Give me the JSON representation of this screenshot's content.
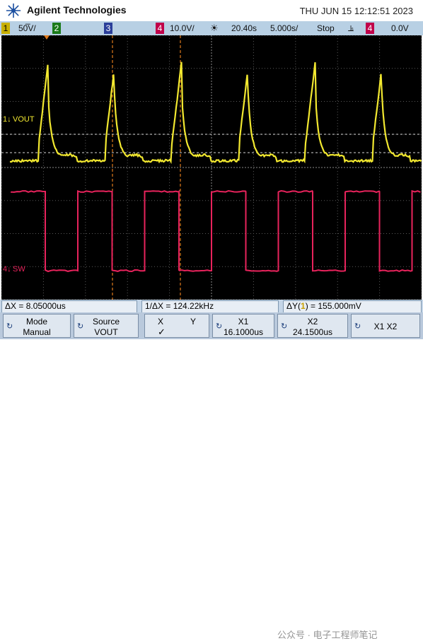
{
  "brand": "Agilent Technologies",
  "datetime": "THU JUN 15 12:12:51 2023",
  "status": {
    "ch1_num": "1",
    "ch1_scale": "50̅V/",
    "ch2_num": "2",
    "ch3_num": "3",
    "ch4_num": "4",
    "ch4_scale": "10.0V/",
    "trig_icon": "☀",
    "time_offset": "20.40s",
    "time_scale": "5.000s/",
    "run_state": "Stop",
    "trig_symbol": "⫡",
    "trig_ch_num": "4",
    "trig_level": "0.0V"
  },
  "channels": {
    "ch1_label": "VOUT",
    "ch1_marker": "1↓",
    "ch4_label": "SW",
    "ch4_marker": "4↓"
  },
  "measurements": {
    "delta_x": "ΔX = 8.05000us",
    "inv_delta_x": "1/ΔX = 124.22kHz",
    "delta_y_prefix": "ΔY(",
    "delta_y_ch": "1",
    "delta_y_suffix": ") = 155.000mV"
  },
  "softkeys": {
    "mode_title": "Mode",
    "mode_value": "Manual",
    "source_title": "Source",
    "source_value": "VOUT",
    "x_label": "X",
    "y_label": "Y",
    "check": "✓",
    "x1_title": "X1",
    "x1_value": "16.1000us",
    "x2_title": "X2",
    "x2_value": "24.1500us",
    "x1x2": "X1 X2"
  },
  "watermark": "公众号 · 电子工程师笔记",
  "colors": {
    "ch1": "#f2e830",
    "ch4": "#e8235c",
    "cursor": "#e07a1c",
    "grid": "#5a5a5a"
  }
}
